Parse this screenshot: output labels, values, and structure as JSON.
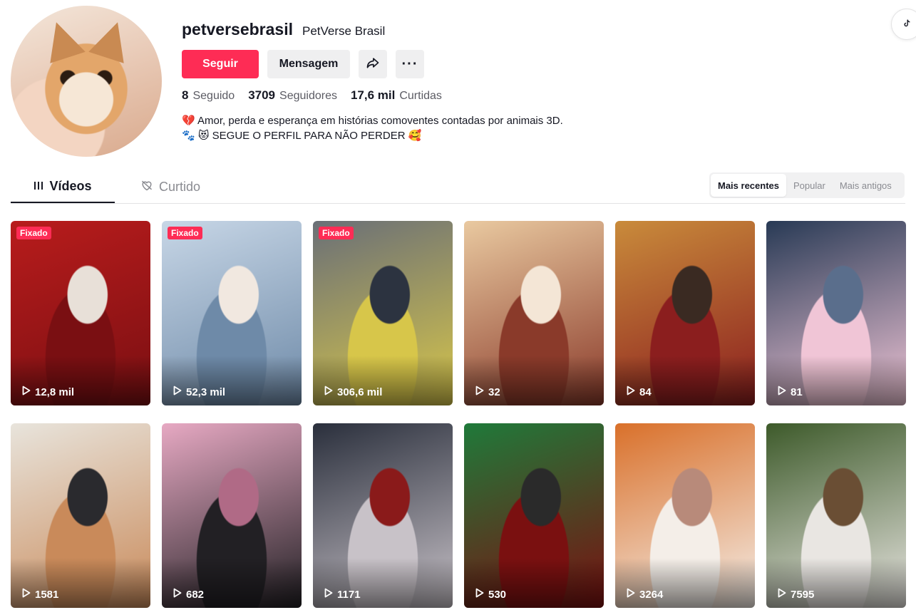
{
  "profile": {
    "username": "petversebrasil",
    "nickname": "PetVerse Brasil",
    "follow_label": "Seguir",
    "message_label": "Mensagem",
    "more_label": "···",
    "stats": [
      {
        "value": "8",
        "label": "Seguido"
      },
      {
        "value": "3709",
        "label": "Seguidores"
      },
      {
        "value": "17,6 mil",
        "label": "Curtidas"
      }
    ],
    "bio_lines": [
      "💔 Amor, perda e esperança em histórias comoventes contadas por animais 3D.",
      "🐾 😻 SEGUE O PERFIL PARA NÃO PERDER 🥰"
    ]
  },
  "tabs": [
    {
      "label": "Vídeos"
    },
    {
      "label": "Curtido"
    }
  ],
  "sort_options": [
    "Mais recentes",
    "Popular",
    "Mais antigos"
  ],
  "pinned_label": "Fixado",
  "videos": [
    {
      "views": "12,8 mil",
      "pinned": true,
      "colors": [
        "#b81c1c",
        "#7a0f12",
        "#e8e0d8"
      ]
    },
    {
      "views": "52,3 mil",
      "pinned": true,
      "colors": [
        "#c7d6e6",
        "#6e8aa8",
        "#f1e8e0"
      ]
    },
    {
      "views": "306,6 mil",
      "pinned": true,
      "colors": [
        "#6a6f77",
        "#d7c64a",
        "#2c3340"
      ]
    },
    {
      "views": "32",
      "pinned": false,
      "colors": [
        "#e9c9a0",
        "#8a3a2a",
        "#f4e6d6"
      ]
    },
    {
      "views": "84",
      "pinned": false,
      "colors": [
        "#c98b3b",
        "#8b1e1e",
        "#3a2a22"
      ]
    },
    {
      "views": "81",
      "pinned": false,
      "colors": [
        "#283a55",
        "#f0c5d6",
        "#5a6e8c"
      ]
    },
    {
      "views": "1581",
      "pinned": false,
      "colors": [
        "#e8e4dc",
        "#c98a5a",
        "#2a2a2e"
      ]
    },
    {
      "views": "682",
      "pinned": false,
      "colors": [
        "#e7a9c3",
        "#222024",
        "#b06a86"
      ]
    },
    {
      "views": "1171",
      "pinned": false,
      "colors": [
        "#2a2f3c",
        "#c8c2c8",
        "#8a1a1a"
      ]
    },
    {
      "views": "530",
      "pinned": false,
      "colors": [
        "#1f7a3a",
        "#7a1010",
        "#2a2a2a"
      ]
    },
    {
      "views": "3264",
      "pinned": false,
      "colors": [
        "#d9702a",
        "#f4eee8",
        "#b88a7a"
      ]
    },
    {
      "views": "7595",
      "pinned": false,
      "colors": [
        "#3d5a2a",
        "#e9e6e2",
        "#6a4e34"
      ]
    }
  ]
}
